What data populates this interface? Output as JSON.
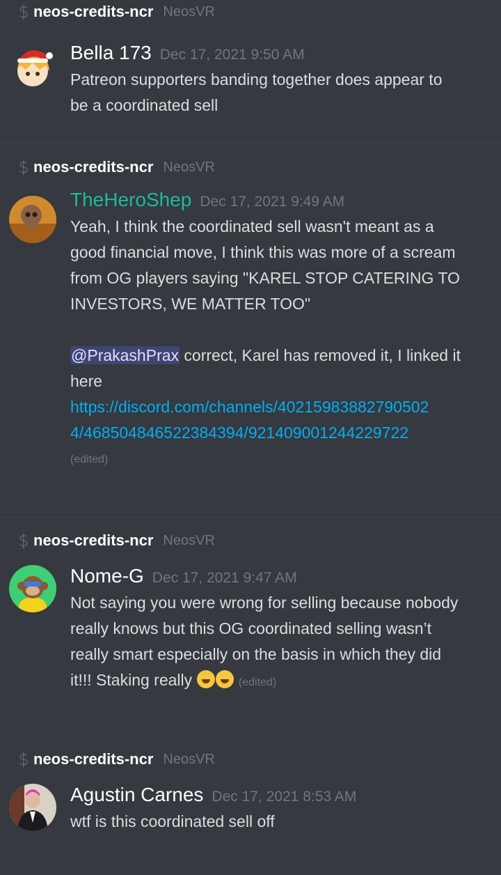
{
  "channel": {
    "name": "neos-credits-ncr",
    "server": "NeosVR"
  },
  "messages": [
    {
      "author": "Bella 173",
      "timestamp": "Dec 17, 2021 9:50 AM",
      "lines": [
        "Patreon supporters banding together does appear to",
        "be a coordinated sell"
      ]
    },
    {
      "author": "TheHeroShep",
      "timestamp": "Dec 17, 2021 9:49 AM",
      "lines": [
        "Yeah, I think the coordinated sell wasn't meant as a",
        "good financial move, I think this was more of a scream",
        "from OG players saying \"KAREL STOP CATERING TO",
        "INVESTORS, WE MATTER TOO\""
      ],
      "mention": "@PrakashPrax",
      "after_mention": " correct, Karel has removed it, I linked it",
      "after_line2": "here",
      "link_line1": "https://discord.com/channels/40215983882790502",
      "link_line2": "4/468504846522384394/921409001244229722",
      "edited": "(edited)"
    },
    {
      "author": "Nome-G",
      "timestamp": "Dec 17, 2021 9:47 AM",
      "lines": [
        "Not saying you were wrong for selling because nobody",
        "really knows but this OG coordinated selling wasn’t",
        "really smart especially on the basis in which they did"
      ],
      "last_line": "it!!! Staking really ",
      "edited": "(edited)",
      "emoji": "rolling-on-floor-laughing"
    },
    {
      "author": "Agustin Carnes",
      "timestamp": "Dec 17, 2021 8:53 AM",
      "lines": [
        "wtf is this coordinated sell off"
      ]
    }
  ],
  "colors": {
    "background": "#36393f",
    "link": "#00aff4",
    "author_green": "#1abc9c",
    "mention_bg": "#4c5387"
  }
}
